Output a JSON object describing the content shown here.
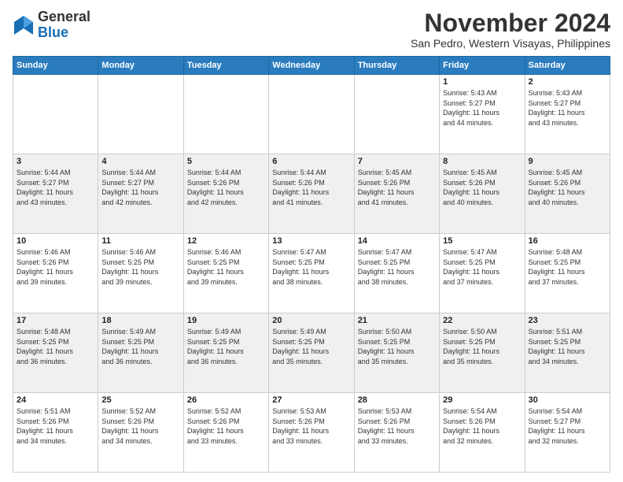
{
  "logo": {
    "general": "General",
    "blue": "Blue"
  },
  "header": {
    "month_title": "November 2024",
    "subtitle": "San Pedro, Western Visayas, Philippines"
  },
  "weekdays": [
    "Sunday",
    "Monday",
    "Tuesday",
    "Wednesday",
    "Thursday",
    "Friday",
    "Saturday"
  ],
  "weeks": [
    [
      {
        "day": "",
        "info": ""
      },
      {
        "day": "",
        "info": ""
      },
      {
        "day": "",
        "info": ""
      },
      {
        "day": "",
        "info": ""
      },
      {
        "day": "",
        "info": ""
      },
      {
        "day": "1",
        "info": "Sunrise: 5:43 AM\nSunset: 5:27 PM\nDaylight: 11 hours\nand 44 minutes."
      },
      {
        "day": "2",
        "info": "Sunrise: 5:43 AM\nSunset: 5:27 PM\nDaylight: 11 hours\nand 43 minutes."
      }
    ],
    [
      {
        "day": "3",
        "info": "Sunrise: 5:44 AM\nSunset: 5:27 PM\nDaylight: 11 hours\nand 43 minutes."
      },
      {
        "day": "4",
        "info": "Sunrise: 5:44 AM\nSunset: 5:27 PM\nDaylight: 11 hours\nand 42 minutes."
      },
      {
        "day": "5",
        "info": "Sunrise: 5:44 AM\nSunset: 5:26 PM\nDaylight: 11 hours\nand 42 minutes."
      },
      {
        "day": "6",
        "info": "Sunrise: 5:44 AM\nSunset: 5:26 PM\nDaylight: 11 hours\nand 41 minutes."
      },
      {
        "day": "7",
        "info": "Sunrise: 5:45 AM\nSunset: 5:26 PM\nDaylight: 11 hours\nand 41 minutes."
      },
      {
        "day": "8",
        "info": "Sunrise: 5:45 AM\nSunset: 5:26 PM\nDaylight: 11 hours\nand 40 minutes."
      },
      {
        "day": "9",
        "info": "Sunrise: 5:45 AM\nSunset: 5:26 PM\nDaylight: 11 hours\nand 40 minutes."
      }
    ],
    [
      {
        "day": "10",
        "info": "Sunrise: 5:46 AM\nSunset: 5:26 PM\nDaylight: 11 hours\nand 39 minutes."
      },
      {
        "day": "11",
        "info": "Sunrise: 5:46 AM\nSunset: 5:25 PM\nDaylight: 11 hours\nand 39 minutes."
      },
      {
        "day": "12",
        "info": "Sunrise: 5:46 AM\nSunset: 5:25 PM\nDaylight: 11 hours\nand 39 minutes."
      },
      {
        "day": "13",
        "info": "Sunrise: 5:47 AM\nSunset: 5:25 PM\nDaylight: 11 hours\nand 38 minutes."
      },
      {
        "day": "14",
        "info": "Sunrise: 5:47 AM\nSunset: 5:25 PM\nDaylight: 11 hours\nand 38 minutes."
      },
      {
        "day": "15",
        "info": "Sunrise: 5:47 AM\nSunset: 5:25 PM\nDaylight: 11 hours\nand 37 minutes."
      },
      {
        "day": "16",
        "info": "Sunrise: 5:48 AM\nSunset: 5:25 PM\nDaylight: 11 hours\nand 37 minutes."
      }
    ],
    [
      {
        "day": "17",
        "info": "Sunrise: 5:48 AM\nSunset: 5:25 PM\nDaylight: 11 hours\nand 36 minutes."
      },
      {
        "day": "18",
        "info": "Sunrise: 5:49 AM\nSunset: 5:25 PM\nDaylight: 11 hours\nand 36 minutes."
      },
      {
        "day": "19",
        "info": "Sunrise: 5:49 AM\nSunset: 5:25 PM\nDaylight: 11 hours\nand 36 minutes."
      },
      {
        "day": "20",
        "info": "Sunrise: 5:49 AM\nSunset: 5:25 PM\nDaylight: 11 hours\nand 35 minutes."
      },
      {
        "day": "21",
        "info": "Sunrise: 5:50 AM\nSunset: 5:25 PM\nDaylight: 11 hours\nand 35 minutes."
      },
      {
        "day": "22",
        "info": "Sunrise: 5:50 AM\nSunset: 5:25 PM\nDaylight: 11 hours\nand 35 minutes."
      },
      {
        "day": "23",
        "info": "Sunrise: 5:51 AM\nSunset: 5:25 PM\nDaylight: 11 hours\nand 34 minutes."
      }
    ],
    [
      {
        "day": "24",
        "info": "Sunrise: 5:51 AM\nSunset: 5:26 PM\nDaylight: 11 hours\nand 34 minutes."
      },
      {
        "day": "25",
        "info": "Sunrise: 5:52 AM\nSunset: 5:26 PM\nDaylight: 11 hours\nand 34 minutes."
      },
      {
        "day": "26",
        "info": "Sunrise: 5:52 AM\nSunset: 5:26 PM\nDaylight: 11 hours\nand 33 minutes."
      },
      {
        "day": "27",
        "info": "Sunrise: 5:53 AM\nSunset: 5:26 PM\nDaylight: 11 hours\nand 33 minutes."
      },
      {
        "day": "28",
        "info": "Sunrise: 5:53 AM\nSunset: 5:26 PM\nDaylight: 11 hours\nand 33 minutes."
      },
      {
        "day": "29",
        "info": "Sunrise: 5:54 AM\nSunset: 5:26 PM\nDaylight: 11 hours\nand 32 minutes."
      },
      {
        "day": "30",
        "info": "Sunrise: 5:54 AM\nSunset: 5:27 PM\nDaylight: 11 hours\nand 32 minutes."
      }
    ]
  ]
}
